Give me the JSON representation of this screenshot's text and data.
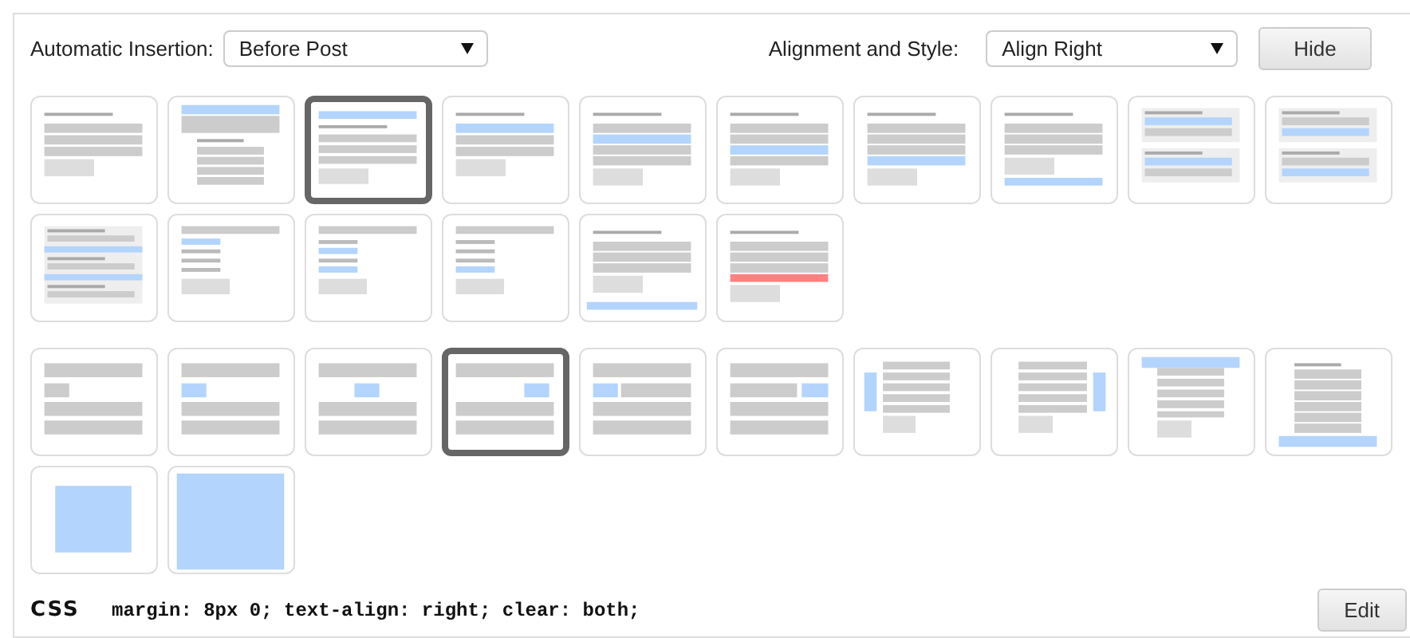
{
  "insertion": {
    "label": "Automatic Insertion:",
    "value": "Before Post"
  },
  "alignment": {
    "label": "Alignment and Style:",
    "value": "Align Right"
  },
  "hide_button": "Hide",
  "insertion_options": [
    {
      "kind": "plain",
      "selected": false
    },
    {
      "kind": "above-title",
      "selected": false
    },
    {
      "kind": "before-title",
      "selected": true
    },
    {
      "kind": "after-title",
      "selected": false
    },
    {
      "kind": "after-paragraph-1",
      "selected": false
    },
    {
      "kind": "after-paragraph-2",
      "selected": false
    },
    {
      "kind": "after-paragraph-3",
      "selected": false
    },
    {
      "kind": "after-content",
      "selected": false
    },
    {
      "kind": "between-posts-1",
      "selected": false
    },
    {
      "kind": "between-posts-2",
      "selected": false
    },
    {
      "kind": "between-posts-3",
      "selected": false
    },
    {
      "kind": "list-1",
      "selected": false
    },
    {
      "kind": "list-2",
      "selected": false
    },
    {
      "kind": "list-3",
      "selected": false
    },
    {
      "kind": "footer",
      "selected": false
    },
    {
      "kind": "warning",
      "selected": false
    }
  ],
  "style_options": [
    {
      "kind": "default",
      "selected": false
    },
    {
      "kind": "left",
      "selected": false
    },
    {
      "kind": "center",
      "selected": false
    },
    {
      "kind": "right",
      "selected": true
    },
    {
      "kind": "float-left",
      "selected": false
    },
    {
      "kind": "float-right",
      "selected": false
    },
    {
      "kind": "sticky-left",
      "selected": false
    },
    {
      "kind": "sticky-right",
      "selected": false
    },
    {
      "kind": "sticky-top",
      "selected": false
    },
    {
      "kind": "sticky-bottom",
      "selected": false
    },
    {
      "kind": "popup",
      "selected": false
    },
    {
      "kind": "fullscreen",
      "selected": false
    }
  ],
  "css": {
    "label": "CSS",
    "code": "margin: 8px 0; text-align: right; clear: both;"
  },
  "edit_button": "Edit"
}
